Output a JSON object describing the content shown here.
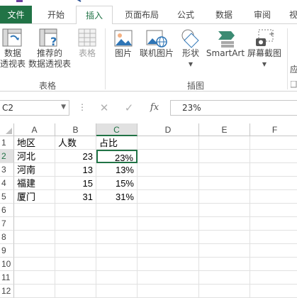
{
  "tabs": [
    {
      "label": "文件",
      "kind": "file"
    },
    {
      "label": "开始",
      "kind": "normal"
    },
    {
      "label": "插入",
      "kind": "active"
    },
    {
      "label": "页面布局",
      "kind": "normal"
    },
    {
      "label": "公式",
      "kind": "normal"
    },
    {
      "label": "数据",
      "kind": "normal"
    },
    {
      "label": "审阅",
      "kind": "normal"
    },
    {
      "label": "视",
      "kind": "normal"
    }
  ],
  "ribbon": {
    "tables_group": {
      "label": "表格",
      "pivot_line1": "数据",
      "pivot_line2": "透视表",
      "recommended_line1": "推荐的",
      "recommended_line2": "数据透视表",
      "table": "表格"
    },
    "illustrations_group": {
      "label": "插图",
      "pictures": "图片",
      "online_pictures": "联机图片",
      "shapes": "形状",
      "smartart": "SmartArt",
      "screenshot": "屏幕截图"
    },
    "next_group_partial": "应"
  },
  "formula_bar": {
    "name_box": "C2",
    "cancel_symbol": "✕",
    "enter_symbol": "✓",
    "fx_label": "fx",
    "value": "23%"
  },
  "sheet": {
    "columns": [
      "A",
      "B",
      "C",
      "D",
      "E",
      "F"
    ],
    "selected_column": "C",
    "selected_row": "2",
    "rows": [
      {
        "num": "1",
        "cells": [
          "地区",
          "人数",
          "占比",
          "",
          "",
          ""
        ]
      },
      {
        "num": "2",
        "cells": [
          "河北",
          "23",
          "23%",
          "",
          "",
          ""
        ]
      },
      {
        "num": "3",
        "cells": [
          "河南",
          "13",
          "13%",
          "",
          "",
          ""
        ]
      },
      {
        "num": "4",
        "cells": [
          "福建",
          "15",
          "15%",
          "",
          "",
          ""
        ]
      },
      {
        "num": "5",
        "cells": [
          "厦门",
          "31",
          "31%",
          "",
          "",
          ""
        ]
      },
      {
        "num": "6",
        "cells": [
          "",
          "",
          "",
          "",
          "",
          ""
        ]
      },
      {
        "num": "7",
        "cells": [
          "",
          "",
          "",
          "",
          "",
          ""
        ]
      },
      {
        "num": "8",
        "cells": [
          "",
          "",
          "",
          "",
          "",
          ""
        ]
      },
      {
        "num": "9",
        "cells": [
          "",
          "",
          "",
          "",
          "",
          ""
        ]
      },
      {
        "num": "10",
        "cells": [
          "",
          "",
          "",
          "",
          "",
          ""
        ]
      },
      {
        "num": "11",
        "cells": [
          "",
          "",
          "",
          "",
          "",
          ""
        ]
      },
      {
        "num": "12",
        "cells": [
          "",
          "",
          "",
          "",
          "",
          ""
        ]
      }
    ]
  },
  "colors": {
    "accent": "#217346",
    "gridline": "#e1e1e1",
    "header_border": "#c6c6c6"
  }
}
